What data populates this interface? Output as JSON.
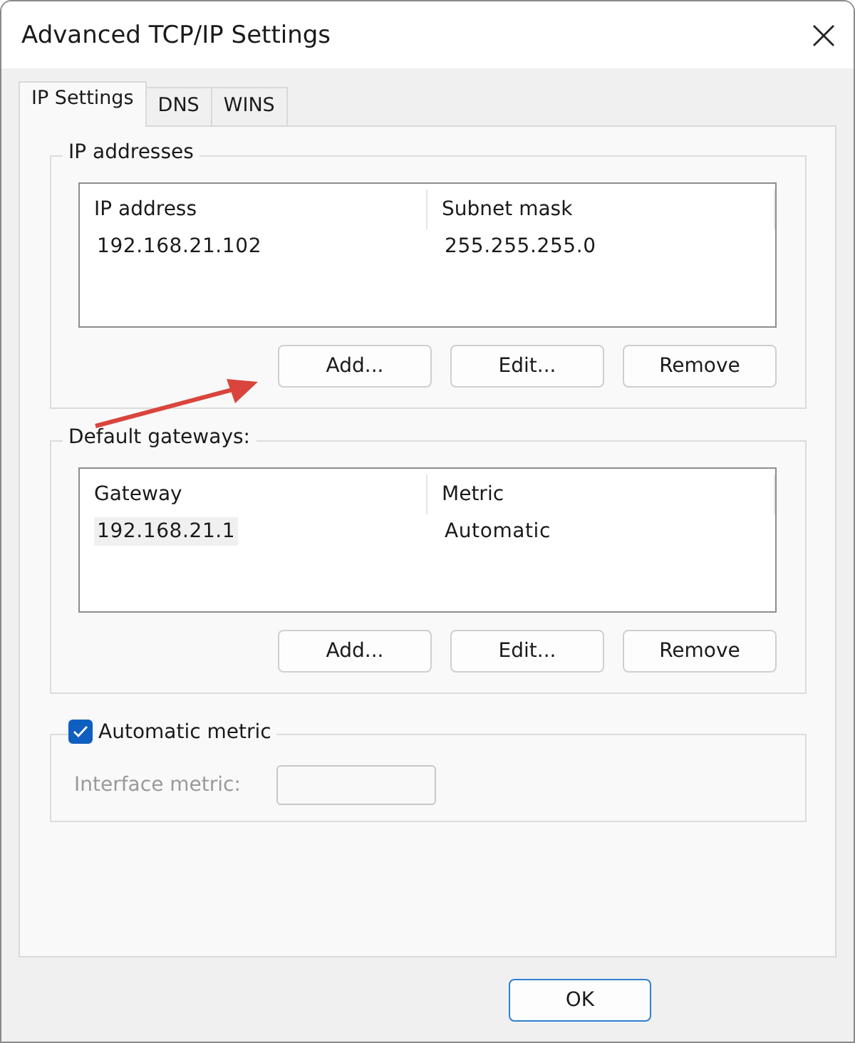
{
  "window": {
    "title": "Advanced TCP/IP Settings"
  },
  "tabs": [
    {
      "label": "IP Settings",
      "selected": true
    },
    {
      "label": "DNS",
      "selected": false
    },
    {
      "label": "WINS",
      "selected": false
    }
  ],
  "groups": [
    {
      "title": "IP addresses",
      "columns": [
        "IP address",
        "Subnet mask"
      ],
      "rows": [
        {
          "cells": [
            "192.168.21.102",
            "255.255.255.0"
          ],
          "selected": false
        }
      ],
      "buttons": [
        "Add...",
        "Edit...",
        "Remove"
      ]
    },
    {
      "title": "Default gateways:",
      "columns": [
        "Gateway",
        "Metric"
      ],
      "rows": [
        {
          "cells": [
            "192.168.21.1",
            "Automatic"
          ],
          "selected": true
        }
      ],
      "buttons": [
        "Add...",
        "Edit...",
        "Remove"
      ]
    }
  ],
  "automatic_metric": {
    "label": "Automatic metric",
    "checked": true,
    "field_label": "Interface metric:",
    "field_disabled": true
  },
  "footer_buttons": [
    {
      "label": "OK",
      "default": true
    }
  ]
}
